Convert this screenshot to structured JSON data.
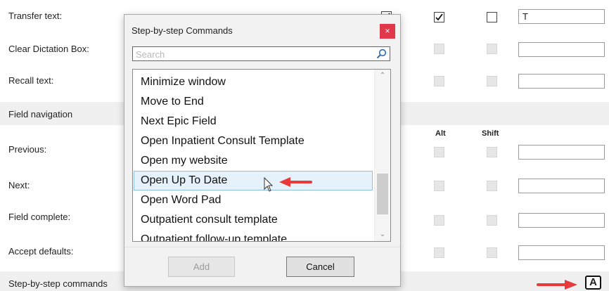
{
  "settings": {
    "rows": [
      {
        "label": "Transfer text:"
      },
      {
        "label": "Clear Dictation Box:"
      },
      {
        "label": "Recall text:"
      },
      {
        "label": "Previous:"
      },
      {
        "label": "Next:"
      },
      {
        "label": "Field complete:"
      },
      {
        "label": "Accept defaults:"
      }
    ],
    "section_field_navigation": "Field navigation",
    "section_step_commands": "Step-by-step commands",
    "col_alt": "Alt",
    "col_shift": "Shift",
    "transfer_key_value": "T",
    "hotkey_badge": "A"
  },
  "dialog": {
    "title": "Step-by-step Commands",
    "close_glyph": "×",
    "search_placeholder": "Search",
    "items": [
      "Minimize window",
      "Move to End",
      "Next Epic Field",
      "Open Inpatient Consult Template",
      "Open my website",
      "Open Up To Date",
      "Open Word Pad",
      "Outpatient consult template",
      "Outpatient follow-up template"
    ],
    "selected_item": "Open Up To Date",
    "add_label": "Add",
    "cancel_label": "Cancel"
  },
  "colors": {
    "annotation_arrow": "#e8393b",
    "close_button": "#e0384a",
    "selection_fill": "#e5f1fb",
    "section_fill": "#f0f0f0"
  }
}
